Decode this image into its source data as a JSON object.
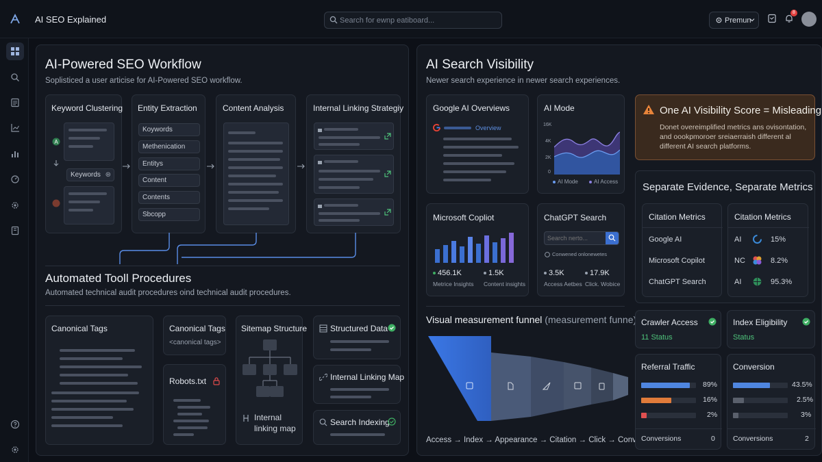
{
  "app": {
    "title": "AI SEO Explained",
    "search_placeholder": "Search for ewnp eatiboard...",
    "premium_label": "Premun",
    "notification_count": "8"
  },
  "workflow": {
    "title": "AI-Powered SEO Workflow",
    "subtitle": "Soplisticed a user articise for AI-Powered SEO workflow.",
    "keyword_clustering": {
      "title": "Keyword Clustering",
      "keywords_label": "Keywords"
    },
    "entity_extraction": {
      "title": "Entity Extraction",
      "items": [
        "Koywords",
        "Methenication",
        "Entitys",
        "Content",
        "Contents",
        "Sbcopp"
      ]
    },
    "content_analysis": {
      "title": "Content Analysis"
    },
    "internal_linking": {
      "title": "Internal Linking Strategiy"
    }
  },
  "procedures": {
    "title": "Automated Tooll Procedures",
    "subtitle": "Automated technical audit procedures oind technical audit procedures.",
    "canonical1": "Canonical Tags",
    "canonical2": "Canonical Tags",
    "canonical2_code": "<canonical tags>",
    "robots": "Robots.txt",
    "sitemap": "Sitemap Structure",
    "internal_linking_map_caption": "Internal linking map",
    "structured_data": "Structured Data",
    "internal_linking_map": "Internal Linking Map",
    "search_indexing": "Search Indexing"
  },
  "visibility": {
    "title": "AI Search Visibility",
    "subtitle": "Newer search experience in newer search experiences.",
    "google_overviews": {
      "title": "Google AI Overviews",
      "tag": "Overview"
    },
    "ai_mode": {
      "title": "AI Mode",
      "ticks": [
        "16K",
        "4K",
        "2K",
        "0"
      ],
      "legend": [
        "AI Mode",
        "AI Access"
      ]
    },
    "copilot": {
      "title": "Microsoft Copliot",
      "stats": [
        {
          "value": "456.1K",
          "label": "Metrice Insights"
        },
        {
          "value": "1.5K",
          "label": "Content insights"
        }
      ]
    },
    "chatgpt": {
      "title": "ChatGPT Search",
      "search_placeholder": "Search nerto...",
      "check_label": "Conwened onlonewetes",
      "stats": [
        {
          "value": "3.5K",
          "label": "Access Aetbes"
        },
        {
          "value": "17.9K",
          "label": "Click. Wobice"
        }
      ]
    },
    "alert": {
      "title": "One AI Visibility Score = Misleading",
      "body": [
        "Donet overeimplified metrics ans ovisontation,",
        "and oookpmoroer sreiaerraish different al",
        "different AI search platforms."
      ]
    },
    "evidence": {
      "title": "Separate Evidence, Separate Metrics",
      "left": {
        "title": "Citation Metrics",
        "items": [
          "Google AI",
          "Microsoft Copilot",
          "ChatGPT Search"
        ]
      },
      "right": {
        "title": "Citation Metrics",
        "rows": [
          {
            "label": "AI",
            "value": "15%"
          },
          {
            "label": "NC",
            "value": "8.2%"
          },
          {
            "label": "AI",
            "value": "95.3%"
          }
        ]
      }
    },
    "funnel": {
      "title": "Visual measurement funnel",
      "title_suffix": "(measurement funne)",
      "steps": [
        "Access",
        "Index",
        "Appearance",
        "Citation",
        "Click",
        "Conversion"
      ]
    },
    "crawler": {
      "title": "Crawler Access",
      "status": "11 Status"
    },
    "index": {
      "title": "Index Eligibility",
      "status": "Status"
    },
    "referral": {
      "title": "Referral Traffic",
      "bars": [
        {
          "value": "89%",
          "fraction": 0.89,
          "color": "#4f86e0"
        },
        {
          "value": "16%",
          "fraction": 0.55,
          "color": "#e07b3a"
        },
        {
          "value": "2%",
          "fraction": 0.1,
          "color": "#e05050"
        }
      ],
      "footer_label": "Conversions",
      "footer_value": "0"
    },
    "conversion": {
      "title": "Conversion",
      "bars": [
        {
          "value": "43.5%",
          "fraction": 0.68,
          "color": "#4f86e0"
        },
        {
          "value": "2.5%",
          "fraction": 0.2,
          "color": "#5a606c"
        },
        {
          "value": "3%",
          "fraction": 0.1,
          "color": "#5a606c"
        }
      ],
      "footer_label": "Conversions",
      "footer_value": "2"
    }
  }
}
